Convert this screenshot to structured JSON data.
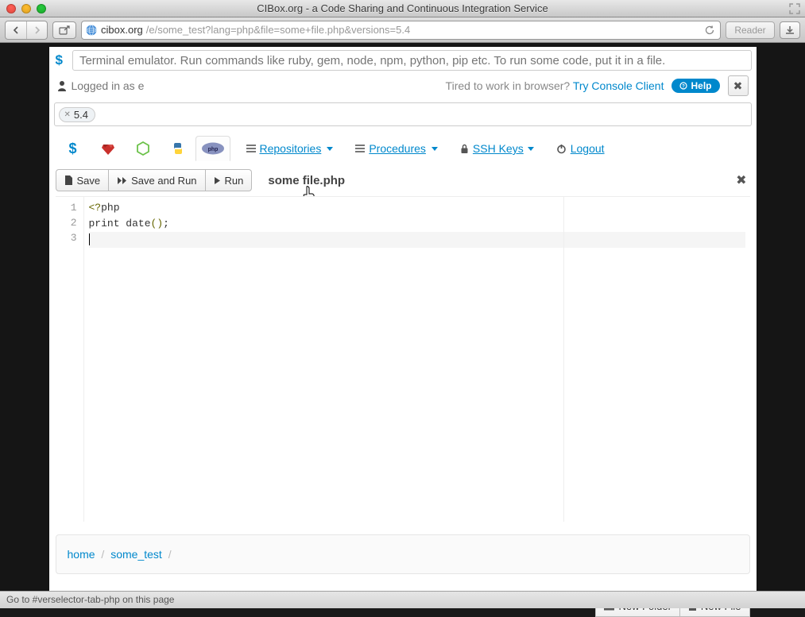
{
  "window": {
    "title": "CIBox.org - a Code Sharing and Continuous Integration Service"
  },
  "browser": {
    "url_host": "cibox.org",
    "url_path": "/e/some_test?lang=php&file=some+file.php&versions=5.4",
    "reader_label": "Reader"
  },
  "terminal": {
    "prompt": "$",
    "placeholder": "Terminal emulator. Run commands like ruby, gem, node, npm, python, pip etc. To run some code, put it in a file."
  },
  "session": {
    "logged_in_prefix": "Logged in as ",
    "username": "e",
    "tired_text": "Tired to work in browser? ",
    "console_link": "Try Console Client",
    "help_label": "Help"
  },
  "version": {
    "tag": "5.4"
  },
  "nav": {
    "repositories": "Repositories",
    "procedures": "Procedures",
    "sshkeys": "SSH Keys",
    "logout": "Logout"
  },
  "actions": {
    "save": "Save",
    "save_and_run": "Save and Run",
    "run": "Run"
  },
  "file": {
    "name": "some file.php"
  },
  "editor": {
    "lines": [
      "<?php",
      "print date();",
      ""
    ]
  },
  "breadcrumb": {
    "home": "home",
    "item": "some_test"
  },
  "footer": {
    "new_folder": "New Folder",
    "new_file": "New File"
  },
  "statusbar": {
    "text": "Go to #verselector-tab-php on this page"
  }
}
